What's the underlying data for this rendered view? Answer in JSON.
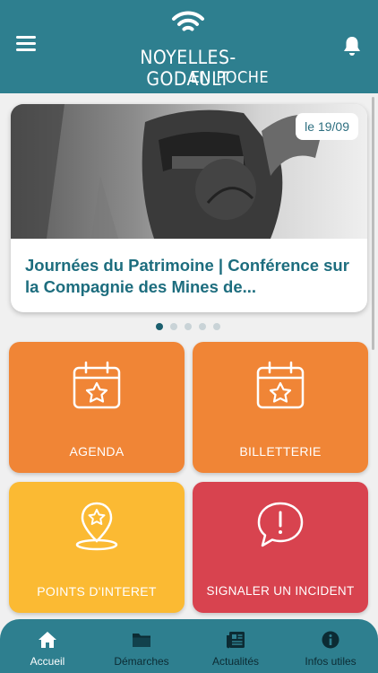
{
  "header": {
    "logo_line1": "NOYELLES-GODAULT",
    "logo_line2": "EN POCHE",
    "menu_icon": "hamburger-icon",
    "notification_icon": "bell-icon"
  },
  "news_card": {
    "date_badge": "le 19/09",
    "title": "Journées du Patrimoine | Conférence sur la Compagnie des Mines de..."
  },
  "carousel": {
    "count": 5,
    "active_index": 0
  },
  "tiles": [
    {
      "label": "AGENDA",
      "icon": "calendar-star-icon",
      "color": "#f08536"
    },
    {
      "label": "BILLETTERIE",
      "icon": "calendar-star-icon",
      "color": "#f08536"
    },
    {
      "label": "POINTS D'INTERET",
      "icon": "map-pin-star-icon",
      "color": "#fbba33"
    },
    {
      "label": "SIGNALER UN INCIDENT",
      "icon": "alert-bubble-icon",
      "color": "#d8434f"
    }
  ],
  "tabbar": {
    "tabs": [
      {
        "label": "Accueil",
        "icon": "home-icon",
        "active": true
      },
      {
        "label": "Démarches",
        "icon": "folder-icon",
        "active": false
      },
      {
        "label": "Actualités",
        "icon": "newspaper-icon",
        "active": false
      },
      {
        "label": "Infos utiles",
        "icon": "info-icon",
        "active": false
      }
    ]
  },
  "colors": {
    "primary": "#2e7f8f",
    "title_text": "#1d6d7e",
    "orange": "#f08536",
    "yellow": "#fbba33",
    "red": "#d8434f"
  }
}
